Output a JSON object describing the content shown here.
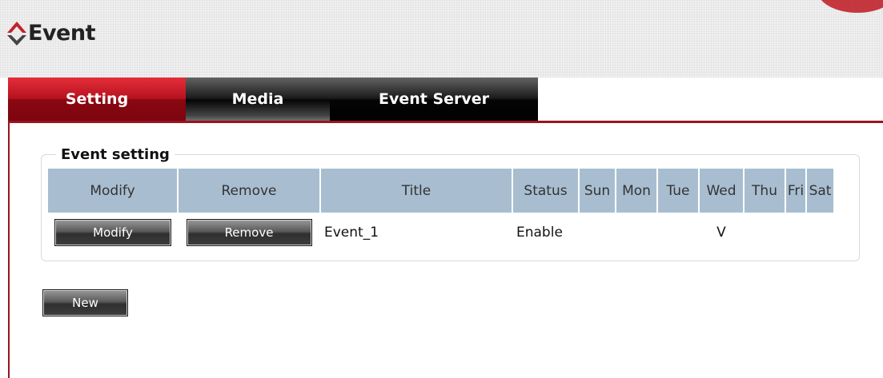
{
  "header": {
    "title": "Event"
  },
  "tabs": [
    {
      "label": "Setting",
      "active": true
    },
    {
      "label": "Media",
      "active": false
    },
    {
      "label": "Event Server",
      "active": false
    }
  ],
  "event_setting": {
    "legend": "Event setting",
    "columns": [
      "Modify",
      "Remove",
      "Title",
      "Status",
      "Sun",
      "Mon",
      "Tue",
      "Wed",
      "Thu",
      "Fri",
      "Sat"
    ],
    "rows": [
      {
        "modify_label": "Modify",
        "remove_label": "Remove",
        "title": "Event_1",
        "status": "Enable",
        "days": [
          "",
          "",
          "",
          "V",
          "",
          "",
          ""
        ]
      }
    ]
  },
  "new_button": "New",
  "colors": {
    "accent": "#b7121f",
    "table_header": "#a8bed0"
  }
}
